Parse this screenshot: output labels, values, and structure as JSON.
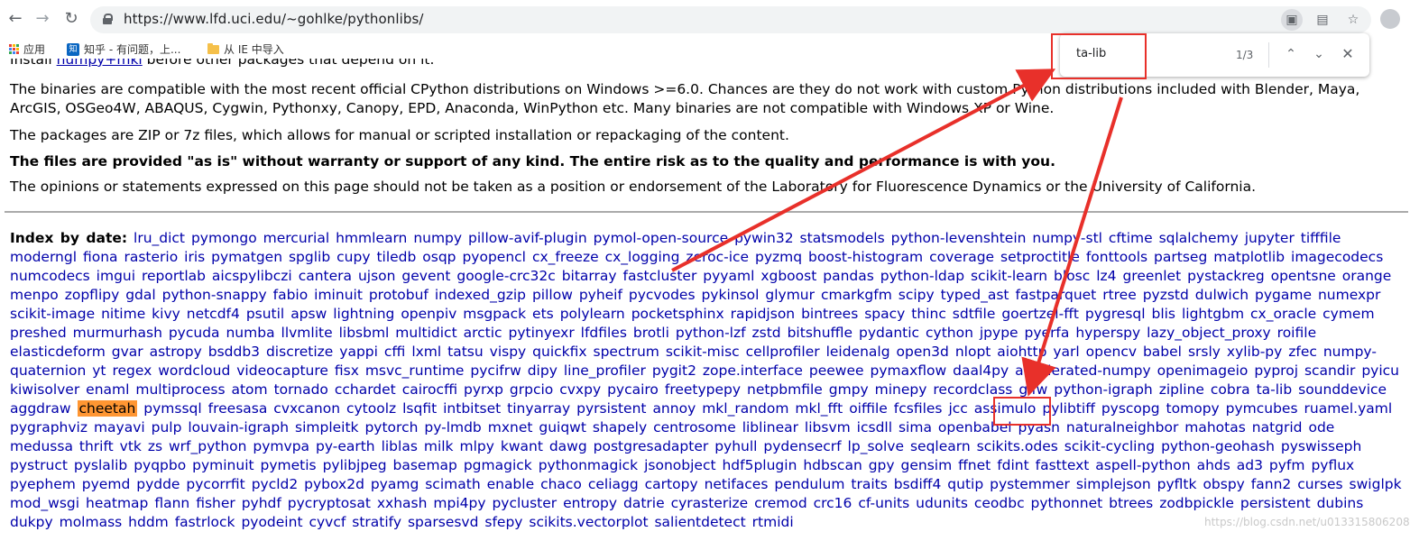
{
  "browser": {
    "url": "https://www.lfd.uci.edu/~gohlke/pythonlibs/",
    "bookmarks": [
      {
        "label": "应用"
      },
      {
        "label": "知乎 - 有问题，上..."
      },
      {
        "label": "从 IE 中导入"
      }
    ],
    "zhihu_icon_text": "知"
  },
  "find_bar": {
    "query": "ta-lib",
    "count": "1/3"
  },
  "page": {
    "clipped_line_prefix": "Install ",
    "clipped_line_link": "numpy+mkl",
    "clipped_line_suffix": " before other packages that depend on it.",
    "para_compat": "The binaries are compatible with the most recent official CPython distributions on Windows >=6.0. Chances are they do not work with custom Python distributions included with Blender, Maya, ArcGIS, OSGeo4W, ABAQUS, Cygwin, Pythonxy, Canopy, EPD, Anaconda, WinPython etc. Many binaries are not compatible with Windows XP or Wine.",
    "para_zip": "The packages are ZIP or 7z files, which allows for manual or scripted installation or repackaging of the content.",
    "para_warranty": "The files are provided \"as is\" without warranty or support of any kind. The entire risk as to the quality and performance is with you.",
    "para_opinions": "The opinions or statements expressed on this page should not be taken as a position or endorsement of the Laboratory for Fluorescence Dynamics or the University of California.",
    "index_label": "Index by date:",
    "packages": [
      "lru_dict",
      "pymongo",
      "mercurial",
      "hmmlearn",
      "numpy",
      "pillow-avif-plugin",
      "pymol-open-source",
      "pywin32",
      "statsmodels",
      "python-levenshtein",
      "numpy-stl",
      "cftime",
      "sqlalchemy",
      "jupyter",
      "tifffile",
      "moderngl",
      "fiona",
      "rasterio",
      "iris",
      "pymatgen",
      "spglib",
      "cupy",
      "tiledb",
      "osqp",
      "pyopencl",
      "cx_freeze",
      "cx_logging",
      "zeroc-ice",
      "pyzmq",
      "boost-histogram",
      "coverage",
      "setproctitle",
      "fonttools",
      "partseg",
      "matplotlib",
      "imagecodecs",
      "numcodecs",
      "imgui",
      "reportlab",
      "aicspylibczi",
      "cantera",
      "ujson",
      "gevent",
      "google-crc32c",
      "bitarray",
      "fastcluster",
      "pyyaml",
      "xgboost",
      "pandas",
      "python-ldap",
      "scikit-learn",
      "blosc",
      "lz4",
      "greenlet",
      "pystackreg",
      "opentsne",
      "orange",
      "menpo",
      "zopflipy",
      "gdal",
      "python-snappy",
      "fabio",
      "iminuit",
      "protobuf",
      "indexed_gzip",
      "pillow",
      "pyheif",
      "pycvodes",
      "pykinsol",
      "glymur",
      "cmarkgfm",
      "scipy",
      "typed_ast",
      "fastparquet",
      "rtree",
      "pyzstd",
      "dulwich",
      "pygame",
      "numexpr",
      "scikit-image",
      "nitime",
      "kivy",
      "netcdf4",
      "psutil",
      "apsw",
      "lightning",
      "openpiv",
      "msgpack",
      "ets",
      "polylearn",
      "pocketsphinx",
      "rapidjson",
      "bintrees",
      "spacy",
      "thinc",
      "sdtfile",
      "goertzel-fft",
      "pygresql",
      "blis",
      "lightgbm",
      "cx_oracle",
      "cymem",
      "preshed",
      "murmurhash",
      "pycuda",
      "numba",
      "llvmlite",
      "libsbml",
      "multidict",
      "arctic",
      "pytinyexr",
      "lfdfiles",
      "brotli",
      "python-lzf",
      "zstd",
      "bitshuffle",
      "pydantic",
      "cython",
      "jpype",
      "pyerfa",
      "hyperspy",
      "lazy_object_proxy",
      "roifile",
      "elasticdeform",
      "gvar",
      "astropy",
      "bsddb3",
      "discretize",
      "yappi",
      "cffi",
      "lxml",
      "tatsu",
      "vispy",
      "quickfix",
      "spectrum",
      "scikit-misc",
      "cellprofiler",
      "leidenalg",
      "open3d",
      "nlopt",
      "aiohttp",
      "yarl",
      "opencv",
      "babel",
      "srsly",
      "xylib-py",
      "zfec",
      "numpy-quaternion",
      "yt",
      "regex",
      "wordcloud",
      "videocapture",
      "fisx",
      "msvc_runtime",
      "pycifrw",
      "dipy",
      "line_profiler",
      "pygit2",
      "zope.interface",
      "peewee",
      "pymaxflow",
      "daal4py",
      "accelerated-numpy",
      "openimageio",
      "pyproj",
      "scandir",
      "pyicu",
      "kiwisolver",
      "enaml",
      "multiprocess",
      "atom",
      "tornado",
      "cchardet",
      "cairocffi",
      "pyrxp",
      "grpcio",
      "cvxpy",
      "pycairo",
      "freetypepy",
      "netpbmfile",
      "gmpy",
      "minepy",
      "recordclass",
      "glfw",
      "python-igraph",
      "zipline",
      "cobra",
      "ta-lib",
      "sounddevice",
      "aggdraw",
      "cheetah",
      "pymssql",
      "freesasa",
      "cvxcanon",
      "cytoolz",
      "lsqfit",
      "intbitset",
      "tinyarray",
      "pyrsistent",
      "annoy",
      "mkl_random",
      "mkl_fft",
      "oiffile",
      "fcsfiles",
      "jcc",
      "assimulo",
      "pylibtiff",
      "pyscopg",
      "tomopy",
      "pymcubes",
      "ruamel.yaml",
      "pygraphviz",
      "mayavi",
      "pulp",
      "louvain-igraph",
      "simpleitk",
      "pytorch",
      "py-lmdb",
      "mxnet",
      "guiqwt",
      "shapely",
      "centrosome",
      "liblinear",
      "libsvm",
      "icsdll",
      "sima",
      "openbabel",
      "pyasn",
      "naturalneighbor",
      "mahotas",
      "natgrid",
      "ode",
      "medussa",
      "thrift",
      "vtk",
      "zs",
      "wrf_python",
      "pymvpa",
      "py-earth",
      "liblas",
      "milk",
      "mlpy",
      "kwant",
      "dawg",
      "postgresadapter",
      "pyhull",
      "pydensecrf",
      "lp_solve",
      "seqlearn",
      "scikits.odes",
      "scikit-cycling",
      "python-geohash",
      "pyswisseph",
      "pystruct",
      "pyslalib",
      "pyqpbo",
      "pyminuit",
      "pymetis",
      "pylibjpeg",
      "basemap",
      "pgmagick",
      "pythonmagick",
      "jsonobject",
      "hdf5plugin",
      "hdbscan",
      "gpy",
      "gensim",
      "ffnet",
      "fdint",
      "fasttext",
      "aspell-python",
      "ahds",
      "ad3",
      "pyfm",
      "pyflux",
      "pyephem",
      "pyemd",
      "pydde",
      "pycorrfit",
      "pycld2",
      "pybox2d",
      "pyamg",
      "scimath",
      "enable",
      "chaco",
      "celiagg",
      "cartopy",
      "netifaces",
      "pendulum",
      "traits",
      "bsdiff4",
      "qutip",
      "pystemmer",
      "simplejson",
      "pyfltk",
      "obspy",
      "fann2",
      "curses",
      "swiglpk",
      "mod_wsgi",
      "heatmap",
      "flann",
      "fisher",
      "pyhdf",
      "pycryptosat",
      "xxhash",
      "mpi4py",
      "pycluster",
      "entropy",
      "datrie",
      "cyrasterize",
      "cremod",
      "crc16",
      "cf-units",
      "udunits",
      "ceodbc",
      "pythonnet",
      "btrees",
      "zodbpickle",
      "persistent",
      "dubins",
      "dukpy",
      "molmass",
      "hddm",
      "fastrlock",
      "pyodeint",
      "cyvcf",
      "stratify",
      "sparsesvd",
      "sfepy",
      "scikits.vectorplot",
      "salientdetect",
      "rtmidi"
    ],
    "highlight_index": 190
  },
  "watermark": "https://blog.csdn.net/u013315806208"
}
